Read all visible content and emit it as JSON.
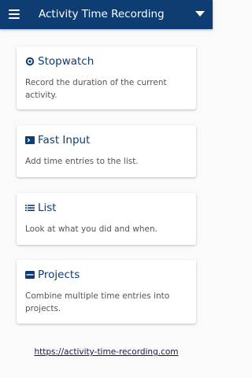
{
  "appbar": {
    "title": "Activity Time Recording",
    "background_color": "#0d3d72"
  },
  "cards": [
    {
      "title": "Stopwatch",
      "description": "Record the duration of the current activity.",
      "icon": "stopwatch-icon"
    },
    {
      "title": "Fast Input",
      "description": "Add time entries to the list.",
      "icon": "terminal-icon"
    },
    {
      "title": "List",
      "description": "Look at what you did and when.",
      "icon": "list-icon"
    },
    {
      "title": "Projects",
      "description": "Combine multiple time entries into projects.",
      "icon": "inbox-icon"
    }
  ],
  "footer": {
    "link_text": "https://activity-time-recording.com"
  },
  "colors": {
    "accent": "#0d3d72",
    "page_background": "#fafafa",
    "card_background": "#ffffff",
    "description_text": "#555555"
  }
}
